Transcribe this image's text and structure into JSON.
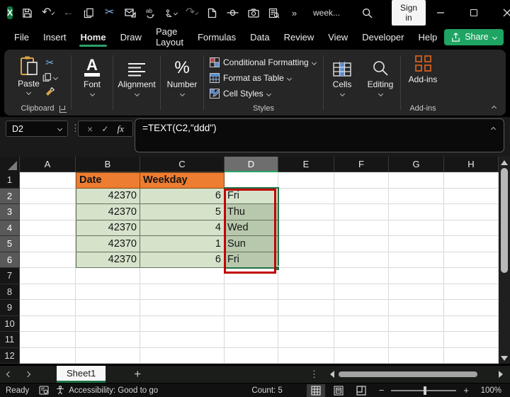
{
  "titlebar": {
    "document_title": "week...",
    "sign_in_label": "Sign in",
    "excel_logo_letter": "X"
  },
  "icons": {
    "undo": "↶",
    "redo": "↷",
    "back": "←",
    "cut": "✂",
    "more": "»",
    "kebab": "⋮",
    "cancel": "×",
    "enter": "✓",
    "fx": "fx",
    "new_sheet": "+",
    "zoom_minus": "−",
    "zoom_plus": "+",
    "percent": "%",
    "font_letter": "A"
  },
  "menubar": {
    "items": [
      "File",
      "Insert",
      "Home",
      "Draw",
      "Page Layout",
      "Formulas",
      "Data",
      "Review",
      "View",
      "Developer",
      "Help"
    ],
    "active_item": "Home",
    "share_label": "Share"
  },
  "ribbon": {
    "paste_label": "Paste",
    "clipboard_group_label": "Clipboard",
    "font_label": "Font",
    "alignment_label": "Alignment",
    "number_label": "Number",
    "styles_items": [
      "Conditional Formatting",
      "Format as Table",
      "Cell Styles"
    ],
    "styles_group_label": "Styles",
    "cells_label": "Cells",
    "editing_label": "Editing",
    "addins_label": "Add-ins",
    "addins_group_label": "Add-ins"
  },
  "formula_bar": {
    "name_box": "D2",
    "formula": "=TEXT(C2,\"ddd\")"
  },
  "grid": {
    "columns": [
      "A",
      "B",
      "C",
      "D",
      "E",
      "F",
      "G",
      "H"
    ],
    "selected_column": "D",
    "row_numbers": [
      "1",
      "2",
      "3",
      "4",
      "5",
      "6",
      "7",
      "8",
      "9",
      "10",
      "11",
      "12"
    ],
    "selected_rows": [
      2,
      3,
      4,
      5,
      6
    ],
    "table": {
      "header_date": "Date",
      "header_weekday": "Weekday",
      "rows": [
        {
          "date": "42370",
          "num": "6",
          "day": "Fri"
        },
        {
          "date": "42370",
          "num": "5",
          "day": "Thu"
        },
        {
          "date": "42370",
          "num": "4",
          "day": "Wed"
        },
        {
          "date": "42370",
          "num": "1",
          "day": "Sun"
        },
        {
          "date": "42370",
          "num": "6",
          "day": "Fri"
        }
      ]
    },
    "selection_range": "D2:D6",
    "active_cell": "D2"
  },
  "sheet_tabs": {
    "active_label": "Sheet1"
  },
  "status_bar": {
    "ready_label": "Ready",
    "accessibility_label": "Accessibility: Good to go",
    "count_label": "Count: 5",
    "zoom_label": "100%"
  },
  "colors": {
    "accent_green": "#1fa463",
    "selection_green": "#217346",
    "header_orange": "#ed7d31",
    "cell_green": "#d6e3cb",
    "cell_green_selected": "#b8c8ac",
    "annotation_red": "#c00000",
    "addins_orange": "#c0581f"
  }
}
